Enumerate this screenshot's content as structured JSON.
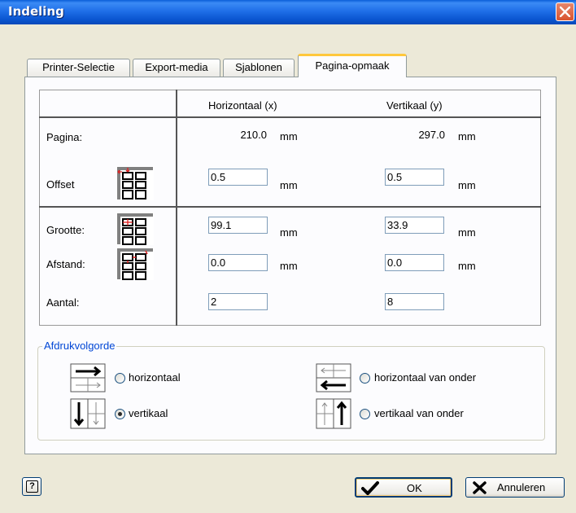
{
  "window": {
    "title": "Indeling"
  },
  "tabs": [
    {
      "label": "Printer-Selectie"
    },
    {
      "label": "Export-media"
    },
    {
      "label": "Sjablonen"
    },
    {
      "label": "Pagina-opmaak"
    }
  ],
  "grid": {
    "col_horizontal": "Horizontaal (x)",
    "col_vertical": "Vertikaal (y)",
    "unit": "mm",
    "pagina": {
      "label": "Pagina:",
      "x": "210.0",
      "y": "297.0"
    },
    "offset": {
      "label": "Offset",
      "x": "0.5",
      "y": "0.5"
    },
    "grootte": {
      "label": "Grootte:",
      "x": "99.1",
      "y": "33.9"
    },
    "afstand": {
      "label": "Afstand:",
      "x": "0.0",
      "y": "0.0"
    },
    "aantal": {
      "label": "Aantal:",
      "x": "2",
      "y": "8"
    }
  },
  "print_order": {
    "title": "Afdrukvolgorde",
    "options": [
      {
        "label": "horizontaal",
        "checked": false
      },
      {
        "label": "horizontaal van onder",
        "checked": false
      },
      {
        "label": "vertikaal",
        "checked": true
      },
      {
        "label": "vertikaal van onder",
        "checked": false
      }
    ]
  },
  "buttons": {
    "help": "?",
    "ok": "OK",
    "cancel": "Annuleren"
  },
  "colors": {
    "title_bar": "#0a55d0",
    "tab_highlight": "#ffc83c",
    "group_title": "#0046d5",
    "panel": "#fcfcfe",
    "dialog": "#ece9d8"
  }
}
